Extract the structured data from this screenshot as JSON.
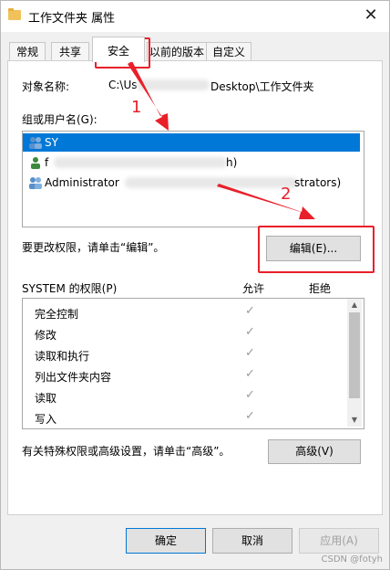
{
  "window": {
    "title": "工作文件夹 属性",
    "close_glyph": "✕"
  },
  "tabs": [
    {
      "label": "常规"
    },
    {
      "label": "共享"
    },
    {
      "label": "安全",
      "active": true
    },
    {
      "label": "以前的版本"
    },
    {
      "label": "自定义"
    }
  ],
  "security": {
    "object_label": "对象名称:",
    "object_value_prefix": "C:\\Us",
    "object_value_suffix": "Desktop\\工作文件夹",
    "group_label": "组或用户名(G):",
    "users": [
      {
        "name": "SY",
        "selected": true
      },
      {
        "name": "f",
        "suffix": "h)"
      },
      {
        "name": "Administrator",
        "suffix": "strators)"
      }
    ],
    "change_hint": "要更改权限，请单击“编辑”。",
    "edit_button": "编辑(E)...",
    "perm_header": "SYSTEM 的权限(P)",
    "allow_label": "允许",
    "deny_label": "拒绝",
    "permissions": [
      {
        "name": "完全控制",
        "allow": true
      },
      {
        "name": "修改",
        "allow": true
      },
      {
        "name": "读取和执行",
        "allow": true
      },
      {
        "name": "列出文件夹内容",
        "allow": true
      },
      {
        "name": "读取",
        "allow": true
      },
      {
        "name": "写入",
        "allow": true
      }
    ],
    "advanced_hint": "有关特殊权限或高级设置，请单击“高级”。",
    "advanced_button": "高级(V)"
  },
  "footer": {
    "ok": "确定",
    "cancel": "取消",
    "apply": "应用(A)"
  },
  "annotations": {
    "num1": "1",
    "num2": "2",
    "color": "#e8202a"
  },
  "watermark": "CSDN @fotyh"
}
